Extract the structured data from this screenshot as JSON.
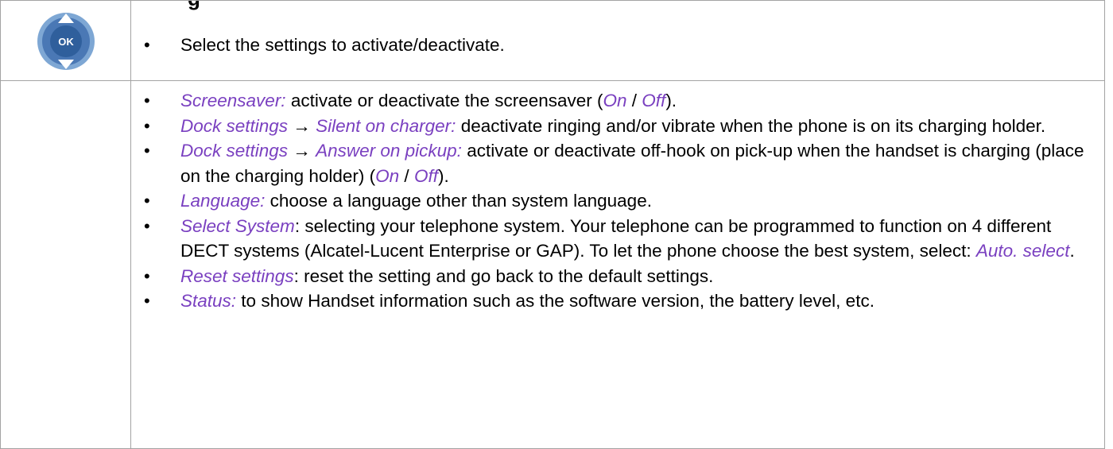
{
  "section_heading_fragment": "g",
  "ok_icon": {
    "name": "ok-navigation-key-icon",
    "label": "OK",
    "colors": {
      "outer": "#7ea7d4",
      "inner": "#2f5f9c",
      "arrows": "#ffffff"
    }
  },
  "accent_color": "#7a40c0",
  "row1": {
    "text": "Select the settings to activate/deactivate."
  },
  "row2": {
    "screensaver": {
      "label": "Screensaver:",
      "text_before": " activate or deactivate the screensaver (",
      "on": "On",
      "sep": " / ",
      "off": "Off",
      "text_after": ")."
    },
    "dock_silent": {
      "label1": "Dock settings",
      "arrow": " → ",
      "label2": "Silent on charger:",
      "text": " deactivate ringing and/or vibrate when the phone is on its charging holder."
    },
    "dock_answer": {
      "label1": "Dock settings",
      "arrow": " → ",
      "label2": "Answer on pickup:",
      "text_before": " activate or deactivate off-hook on pick-up when the handset is charging (place on the charging holder) (",
      "on": "On",
      "sep": " / ",
      "off": "Off",
      "text_after": ")."
    },
    "language": {
      "label": "Language:",
      "text": " choose a language other than system language."
    },
    "select_system": {
      "label": "Select System",
      "text_before": ": selecting your telephone system. Your telephone can be programmed to function on 4 different DECT systems (Alcatel-Lucent Enterprise or GAP). To let the phone choose the best system, select: ",
      "auto": "Auto. select",
      "text_after": "."
    },
    "reset": {
      "label": "Reset settings",
      "text": ": reset the setting and go back to the default settings."
    },
    "status": {
      "label": "Status:",
      "text": " to show Handset information such as the software version, the battery level, etc."
    }
  }
}
